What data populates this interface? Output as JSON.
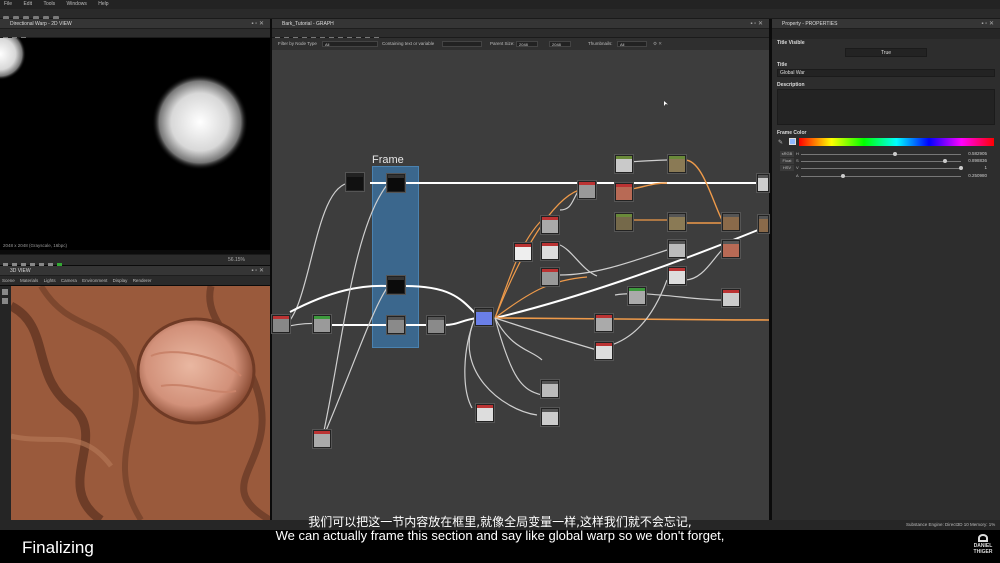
{
  "menu": {
    "items": [
      "File",
      "Edit",
      "Tools",
      "Windows",
      "Help"
    ]
  },
  "panel2d": {
    "title": "Directional Warp - 2D VIEW",
    "status": "2048 x 2048 (Grayscale, 16bpc)",
    "zoom": "56.15%"
  },
  "panel3d": {
    "title": "3D VIEW",
    "tabs": [
      "Scene",
      "Materials",
      "Lights",
      "Camera",
      "Environment",
      "Display",
      "Renderer"
    ]
  },
  "graph": {
    "title": "Bark_Tutorial - GRAPH",
    "filter_label": "Filter by Node Type",
    "filter_value": "All",
    "containing_label": "Containing text or variable",
    "parent_size_label": "Parent Size:",
    "parent_size_value": "2048",
    "size_value": "2048",
    "thumbnails_label": "Thumbnails:",
    "thumbnails_value": "All",
    "frame_title": "Frame"
  },
  "properties": {
    "title": "Property - PROPERTIES",
    "title_visible_label": "Title Visible",
    "title_visible_value": "True",
    "title_label": "Title",
    "title_value": "Global War",
    "description_label": "Description",
    "frame_color_label": "Frame Color",
    "color_rows": [
      {
        "tag": "sRGB",
        "channel": "H",
        "value": "0.582905",
        "level": 0.58
      },
      {
        "tag": "Float",
        "channel": "S",
        "value": "0.898836",
        "level": 0.9
      },
      {
        "tag": "HSV",
        "channel": "V",
        "value": "1",
        "level": 1.0
      },
      {
        "tag": "",
        "channel": "A",
        "value": "0.250980",
        "level": 0.25
      }
    ]
  },
  "statusbar": {
    "engine": "Substance Engine: Direct3D 10  Memory: 1%"
  },
  "subtitles": {
    "zh": "我们可以把这一节内容放在框里,就像全局变量一样,这样我们就不会忘记,",
    "en": "We can actually frame this section and say like global warp so we don't forget,"
  },
  "caption": "Finalizing",
  "logo": {
    "line1": "DANIEL",
    "line2": "THIGER"
  }
}
